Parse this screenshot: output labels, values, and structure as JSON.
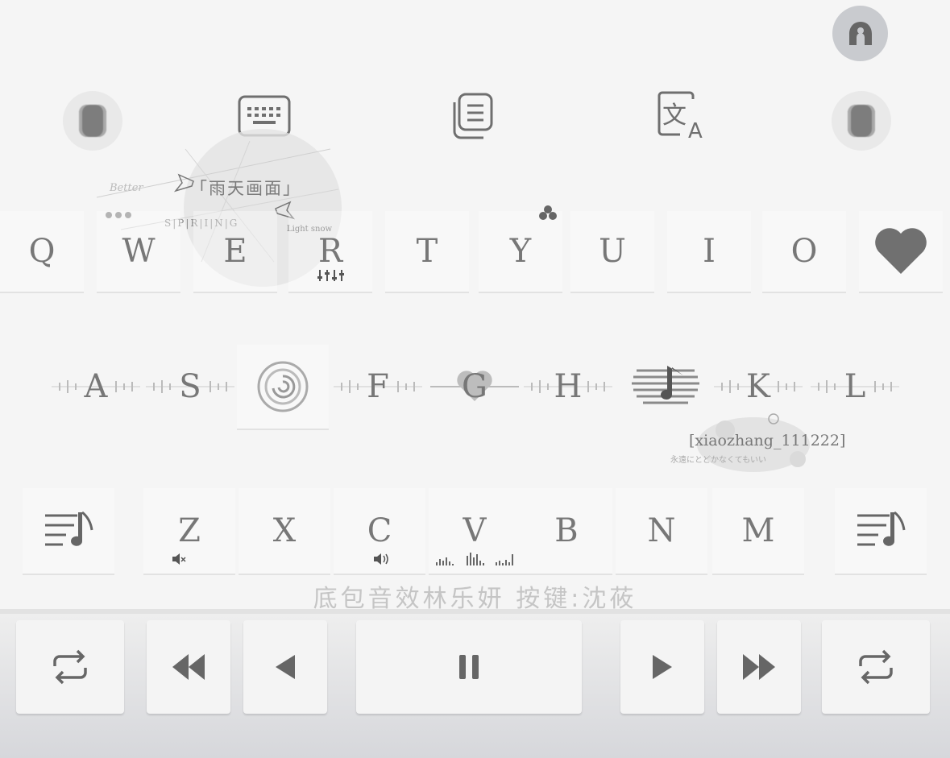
{
  "toolbar": {
    "icons": [
      "skin-icon",
      "keyboard-icon",
      "clipboard-icon",
      "translate-icon",
      "skin-icon"
    ],
    "avatar_icon": "user-avatar-icon"
  },
  "sticker": {
    "title": "「雨天画面」",
    "spring": "S|P|R|I|N|G",
    "snow": "Light snow",
    "signature": "Better"
  },
  "keyboard": {
    "row1": [
      "Q",
      "W",
      "E",
      "R",
      "T",
      "Y",
      "U",
      "I",
      "O"
    ],
    "row1_last_icon": "heart-icon",
    "row2": [
      "A",
      "S",
      "",
      "F",
      "G",
      "H",
      "",
      "K",
      "L"
    ],
    "row2_icons": {
      "d": "spiral-icon",
      "j": "music-note-icon"
    },
    "row3": [
      "Z",
      "X",
      "C",
      "V",
      "B",
      "N",
      "M"
    ],
    "row3_side_icons": "playlist-icon"
  },
  "watermark": {
    "text": "[xiaozhang_111222]",
    "subtext": "永遠にとどかなくてもいい"
  },
  "credit": "底包音效林乐妍 按键:沈莜",
  "player": {
    "buttons": [
      "repeat-icon",
      "fast-rewind-icon",
      "previous-icon",
      "pause-icon",
      "next-icon",
      "fast-forward-icon",
      "repeat-icon"
    ]
  },
  "colors": {
    "background": "#f5f5f5",
    "key_text": "#777777",
    "panel": "#d6d7db"
  }
}
